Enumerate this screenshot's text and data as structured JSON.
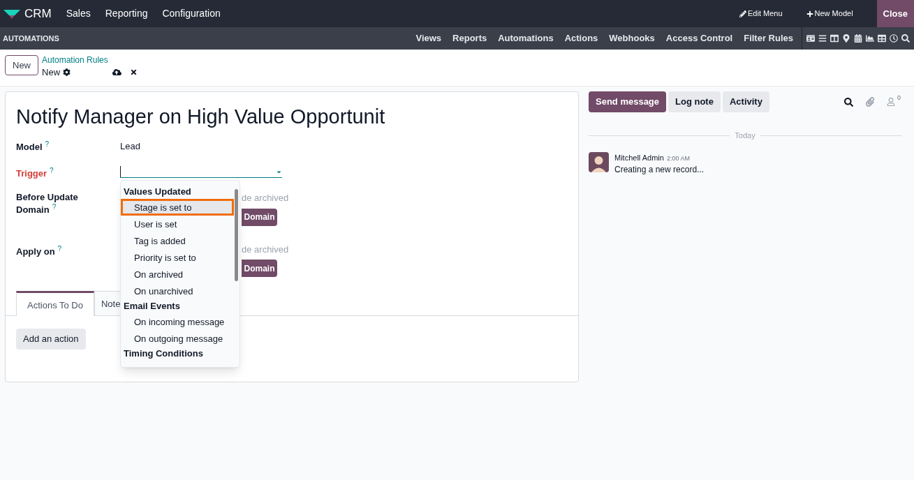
{
  "navbar": {
    "app": "CRM",
    "menu": [
      "Sales",
      "Reporting",
      "Configuration"
    ],
    "actions": [
      {
        "kind": "edit",
        "label": "Edit Menu"
      },
      {
        "kind": "add",
        "label": "New Model"
      }
    ],
    "close": "Close"
  },
  "studio_bar": {
    "title": "AUTOMATIONS",
    "tabs": [
      "Views",
      "Reports",
      "Automations",
      "Actions",
      "Webhooks",
      "Access Control",
      "Filter Rules"
    ]
  },
  "control_panel": {
    "new_button": "New",
    "breadcrumb": "Automation Rules",
    "record": "New"
  },
  "form": {
    "title": "Notify Manager on High Value Opportunit",
    "model": {
      "label": "Model",
      "help": "?",
      "value": "Lead"
    },
    "trigger": {
      "label": "Trigger",
      "help": "?",
      "required": true
    },
    "before_update": {
      "label": "Before Update Domain",
      "help": "?",
      "archived_text": "de archived",
      "domain_button": "Domain"
    },
    "apply_on": {
      "label": "Apply on",
      "help": "?",
      "archived_text": "de archived",
      "domain_button": "Domain"
    },
    "tabs": [
      {
        "label": "Actions To Do",
        "selected": true
      },
      {
        "label": "Note",
        "selected": false
      }
    ],
    "add_action": "Add an action"
  },
  "trigger_dropdown": {
    "groups": [
      {
        "label": "Values Updated",
        "options": [
          {
            "label": "Stage is set to",
            "selected": true
          },
          {
            "label": "User is set",
            "selected": false
          },
          {
            "label": "Tag is added",
            "selected": false
          },
          {
            "label": "Priority is set to",
            "selected": false
          },
          {
            "label": "On archived",
            "selected": false
          },
          {
            "label": "On unarchived",
            "selected": false
          }
        ]
      },
      {
        "label": "Email Events",
        "options": [
          {
            "label": "On incoming message",
            "selected": false
          },
          {
            "label": "On outgoing message",
            "selected": false
          }
        ]
      },
      {
        "label": "Timing Conditions"
      }
    ]
  },
  "chatter": {
    "buttons": [
      {
        "label": "Send message",
        "selected": true
      },
      {
        "label": "Log note",
        "selected": false
      },
      {
        "label": "Activity",
        "selected": false
      }
    ],
    "followers": "0",
    "date_separator": "Today",
    "messages": [
      {
        "author": "Mitchell Admin",
        "time": "2:00 AM",
        "body": "Creating a new record..."
      }
    ]
  }
}
